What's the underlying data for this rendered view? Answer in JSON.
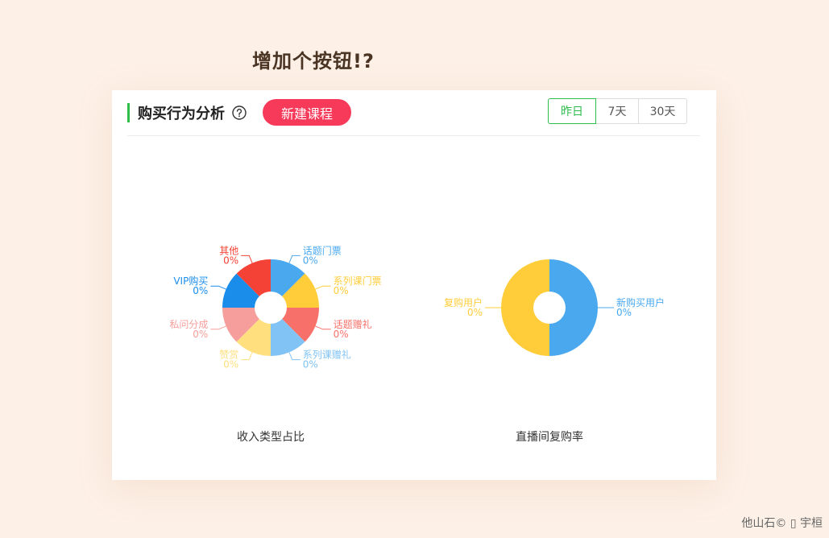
{
  "heading": "增加个按钮!?",
  "card": {
    "title": "购买行为分析",
    "new_button": "新建课程",
    "ranges": [
      "昨日",
      "7天",
      "30天"
    ],
    "active_range": "昨日"
  },
  "chart_data": [
    {
      "type": "pie",
      "title": "收入类型占比",
      "slices": [
        {
          "label": "话题门票",
          "value": 0,
          "percent": "0%",
          "color": "#4aa8ef"
        },
        {
          "label": "系列课门票",
          "value": 0,
          "percent": "0%",
          "color": "#ffcd3a"
        },
        {
          "label": "话题赠礼",
          "value": 0,
          "percent": "0%",
          "color": "#f7716a"
        },
        {
          "label": "系列课赠礼",
          "value": 0,
          "percent": "0%",
          "color": "#80c3f4"
        },
        {
          "label": "赞赏",
          "value": 0,
          "percent": "0%",
          "color": "#ffdf7e"
        },
        {
          "label": "私问分成",
          "value": 0,
          "percent": "0%",
          "color": "#f59e9b"
        },
        {
          "label": "VIP购买",
          "value": 0,
          "percent": "0%",
          "color": "#1a8deb"
        },
        {
          "label": "其他",
          "value": 0,
          "percent": "0%",
          "color": "#f44336"
        }
      ]
    },
    {
      "type": "pie",
      "title": "直播间复购率",
      "slices": [
        {
          "label": "新购买用户",
          "value": 0,
          "percent": "0%",
          "color": "#4aa8ef"
        },
        {
          "label": "复购用户",
          "value": 0,
          "percent": "0%",
          "color": "#ffcd3a"
        }
      ]
    }
  ],
  "watermark": "他山石© ▯ 宇桓"
}
